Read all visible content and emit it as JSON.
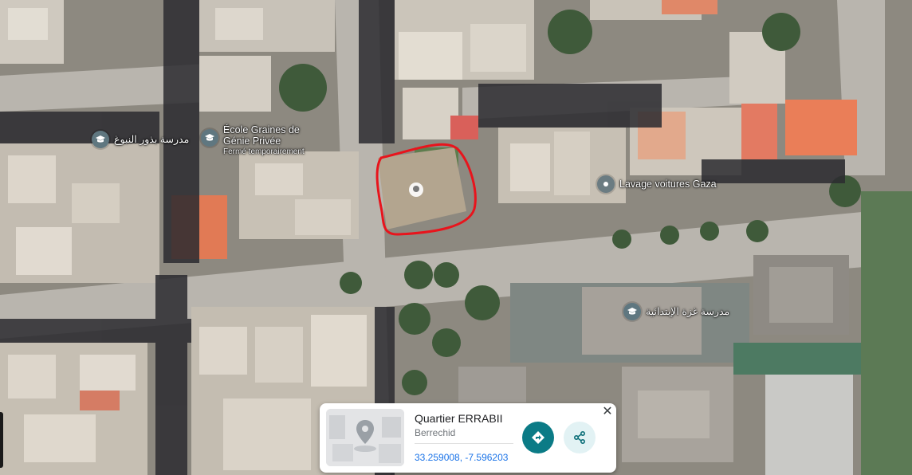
{
  "map": {
    "pois": [
      {
        "id": "school-1",
        "label": "مدرسة بذور النبوغ",
        "sublabel": "",
        "kind": "school"
      },
      {
        "id": "school-2",
        "label": "École Graines de Génie Privée",
        "sublabel": "Fermé temporairement",
        "kind": "school"
      },
      {
        "id": "carwash",
        "label": "Lavage voitures Gaza",
        "sublabel": "",
        "kind": "place"
      },
      {
        "id": "school-3",
        "label": "مدرسة غزة الإبتدائية",
        "sublabel": "",
        "kind": "school"
      }
    ]
  },
  "place_card": {
    "name": "Quartier ERRABII",
    "locality": "Berrechid",
    "coordinates": "33.259008, -7.596203",
    "close_glyph": "✕"
  },
  "colors": {
    "directions_button": "#0b7b86",
    "share_button": "#e2f2f4",
    "annotation_circle": "#e8141c",
    "coords_link": "#1a73e8"
  }
}
